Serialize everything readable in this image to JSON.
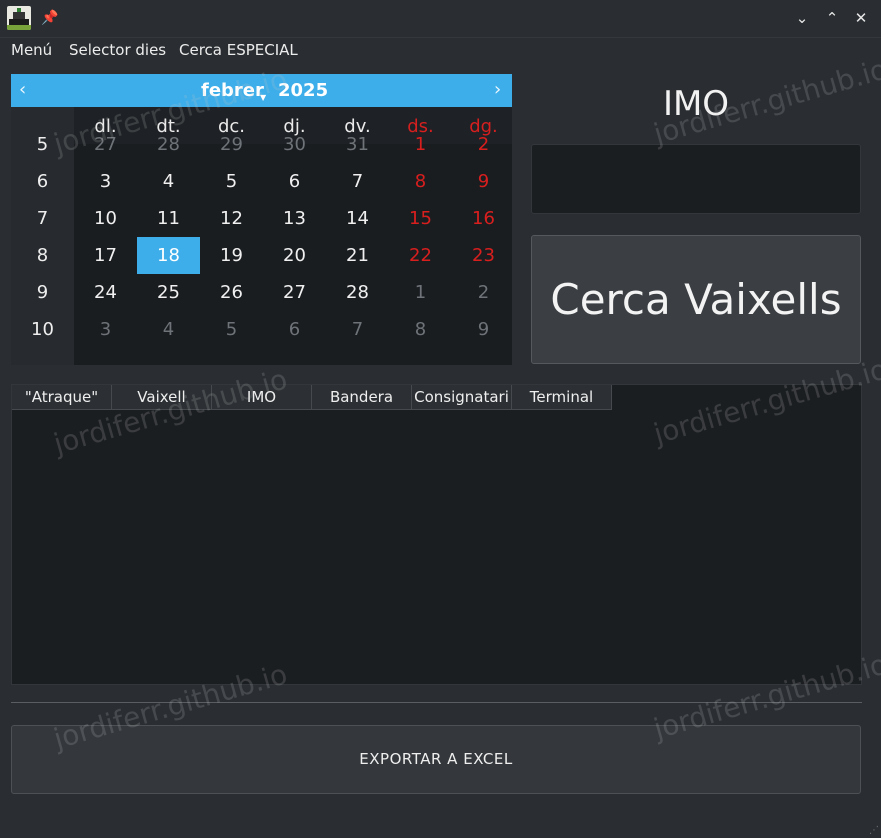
{
  "window": {
    "app_icon": "ship-icon",
    "pin_icon": "pin-icon",
    "controls": {
      "minimize": "⌄",
      "maximize": "⌃",
      "close": "✕"
    }
  },
  "menubar": {
    "items": [
      {
        "label": "Menú"
      },
      {
        "label": "Selector dies"
      },
      {
        "label": "Cerca ESPECIAL"
      }
    ]
  },
  "calendar": {
    "prev": "‹",
    "next": "›",
    "month": "febrer",
    "year": "2025",
    "weekdays": [
      "dl.",
      "dt.",
      "dc.",
      "dj.",
      "dv.",
      "ds.",
      "dg."
    ],
    "weeks": [
      {
        "num": "5",
        "days": [
          "27",
          "28",
          "29",
          "30",
          "31",
          "1",
          "2"
        ]
      },
      {
        "num": "6",
        "days": [
          "3",
          "4",
          "5",
          "6",
          "7",
          "8",
          "9"
        ]
      },
      {
        "num": "7",
        "days": [
          "10",
          "11",
          "12",
          "13",
          "14",
          "15",
          "16"
        ]
      },
      {
        "num": "8",
        "days": [
          "17",
          "18",
          "19",
          "20",
          "21",
          "22",
          "23"
        ]
      },
      {
        "num": "9",
        "days": [
          "24",
          "25",
          "26",
          "27",
          "28",
          "1",
          "2"
        ]
      },
      {
        "num": "10",
        "days": [
          "3",
          "4",
          "5",
          "6",
          "7",
          "8",
          "9"
        ]
      }
    ],
    "selected_day": "18",
    "accent_color": "#3daee9",
    "weekend_color": "#d61f1f"
  },
  "imo": {
    "label": "IMO",
    "value": ""
  },
  "search_button": {
    "label": "Cerca Vaixells"
  },
  "table": {
    "columns": [
      "\"Atraque\"",
      "Vaixell",
      "IMO",
      "Bandera",
      "Consignatari",
      "Terminal"
    ],
    "rows": []
  },
  "export_button": {
    "label": "EXPORTAR  A  EXCEL"
  },
  "watermark": "jordiferr.github.io"
}
